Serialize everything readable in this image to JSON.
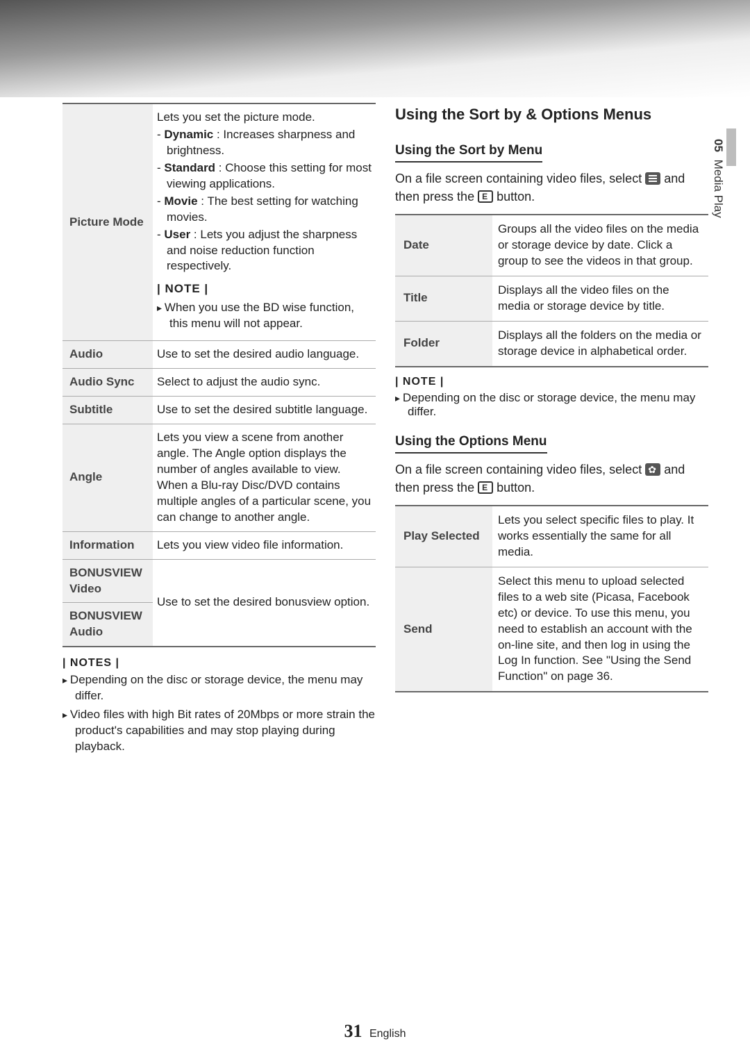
{
  "sidetab": {
    "num": "05",
    "title": "Media Play"
  },
  "left": {
    "pictureMode": {
      "label": "Picture Mode",
      "intro": "Lets you set the picture mode.",
      "items": [
        {
          "name": "Dynamic",
          "desc": " : Increases sharpness and brightness."
        },
        {
          "name": "Standard",
          "desc": " : Choose this setting for most viewing applications."
        },
        {
          "name": "Movie",
          "desc": " : The best setting for watching movies."
        },
        {
          "name": "User",
          "desc": " : Lets you adjust the sharpness and noise reduction function respectively."
        }
      ],
      "noteLabel": "| NOTE |",
      "noteText": "When you use the BD wise function, this menu will not appear."
    },
    "rows": [
      {
        "label": "Audio",
        "desc": "Use to set the desired audio language."
      },
      {
        "label": "Audio Sync",
        "desc": "Select to adjust the audio sync."
      },
      {
        "label": "Subtitle",
        "desc": "Use to set the desired subtitle language."
      },
      {
        "label": "Angle",
        "desc": "Lets you view a scene from another angle. The Angle option displays the number of angles available to view. When a Blu-ray Disc/DVD contains multiple angles of a particular scene, you can change to another angle."
      },
      {
        "label": "Information",
        "desc": "Lets you view video file information."
      }
    ],
    "bonus": {
      "label1": "BONUSVIEW Video",
      "label2": "BONUSVIEW Audio",
      "desc": "Use to set the desired bonusview option."
    },
    "notesLabel": "| NOTES |",
    "notes": [
      "Depending on the disc or storage device, the menu may differ.",
      "Video files with high Bit rates of 20Mbps or more strain the product's capabilities and may stop playing during playback."
    ]
  },
  "right": {
    "h2": "Using the Sort by & Options Menus",
    "sort": {
      "h3": "Using the Sort by Menu",
      "introA": "On a file screen containing video files, select ",
      "introB": " and then press the ",
      "introC": " button.",
      "rows": [
        {
          "label": "Date",
          "desc": "Groups all the video files on the media or storage device by date. Click a group to see the videos in that group."
        },
        {
          "label": "Title",
          "desc": "Displays all the video files on the media or storage device by title."
        },
        {
          "label": "Folder",
          "desc": "Displays all the folders on the media or storage device in alphabetical order."
        }
      ],
      "noteLabel": "| NOTE |",
      "noteText": "Depending on the disc or storage device, the menu may differ."
    },
    "options": {
      "h3": "Using the Options Menu",
      "introA": "On a file screen containing video files, select ",
      "introB": " and then press the ",
      "introC": " button.",
      "rows": [
        {
          "label": "Play Selected",
          "desc": "Lets you select specific files to play. It works essentially the same for all media."
        },
        {
          "label": "Send",
          "desc": "Select this menu to upload selected files to a web site (Picasa, Facebook etc) or device. To use this menu, you need to establish an account with the on-line site, and then log in using the Log In function. See \"Using the Send Function\" on page 36."
        }
      ]
    }
  },
  "footer": {
    "page": "31",
    "lang": "English"
  }
}
